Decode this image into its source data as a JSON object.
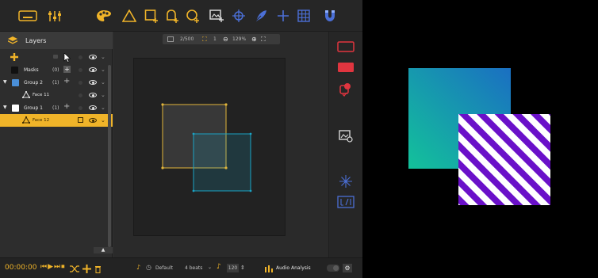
{
  "toolbar": {
    "icons": [
      "keyboard-icon",
      "sliders-icon",
      "palette-icon",
      "triangle-icon",
      "rect-add-icon",
      "shape-add-icon",
      "circle-add-icon",
      "image-add-icon",
      "crosshair-icon",
      "feather-icon",
      "plus-cross-icon",
      "grid-icon",
      "magnet-icon"
    ]
  },
  "layers": {
    "title": "Layers",
    "rows": [
      {
        "label": "Masks",
        "count": "(0)"
      },
      {
        "label": "Group 2",
        "count": "(1)",
        "color": "#4a8fd8"
      },
      {
        "label": "Face 11",
        "count": ""
      },
      {
        "label": "Group 1",
        "count": "(1)",
        "color": "#ffffff"
      },
      {
        "label": "Face 12",
        "count": ""
      }
    ]
  },
  "canvas": {
    "frame": "2/500",
    "layer_count": "1",
    "zoom": "129%"
  },
  "bottom": {
    "timecode": "00:00:00",
    "preset": "Default",
    "beats": "4 beats",
    "bpm": "120",
    "audio_label": "Audio Analysis"
  },
  "colors": {
    "accent": "#f0b429",
    "red": "#e0353f",
    "blue_tool": "#4b6fd6",
    "cyan_face": "#1aa3c4",
    "yellow_face": "#e2b53a",
    "stripe_purple": "#6a10c9"
  }
}
